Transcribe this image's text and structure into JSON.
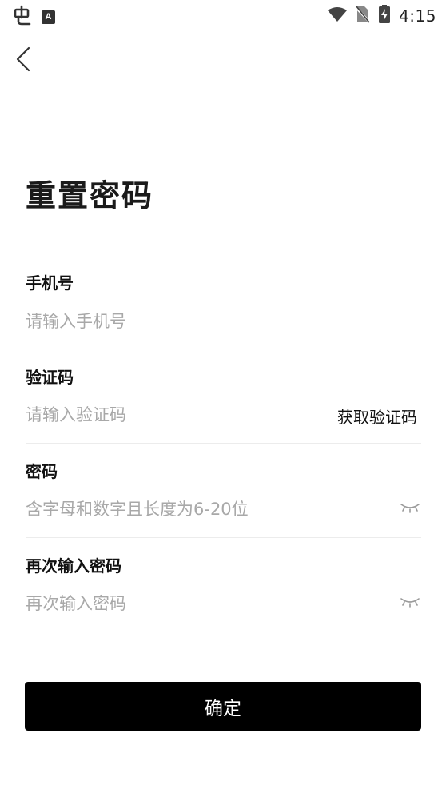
{
  "status_bar": {
    "time": "4:15",
    "left_icons": [
      "bug-icon",
      "a-app-icon"
    ],
    "right_icons": [
      "wifi-icon",
      "no-sim-icon",
      "battery-charging-icon"
    ]
  },
  "page": {
    "title": "重置密码"
  },
  "form": {
    "phone": {
      "label": "手机号",
      "placeholder": "请输入手机号",
      "value": ""
    },
    "code": {
      "label": "验证码",
      "placeholder": "请输入验证码",
      "value": "",
      "get_code_label": "获取验证码"
    },
    "password": {
      "label": "密码",
      "placeholder": "含字母和数字且长度为6-20位",
      "value": "",
      "visibility_icon": "eye-closed-icon"
    },
    "confirm_password": {
      "label": "再次输入密码",
      "placeholder": "再次输入密码",
      "value": "",
      "visibility_icon": "eye-closed-icon"
    }
  },
  "actions": {
    "confirm_label": "确定"
  },
  "colors": {
    "primary_button": "#000000",
    "placeholder": "#a8a8a8",
    "divider": "#ececec"
  }
}
